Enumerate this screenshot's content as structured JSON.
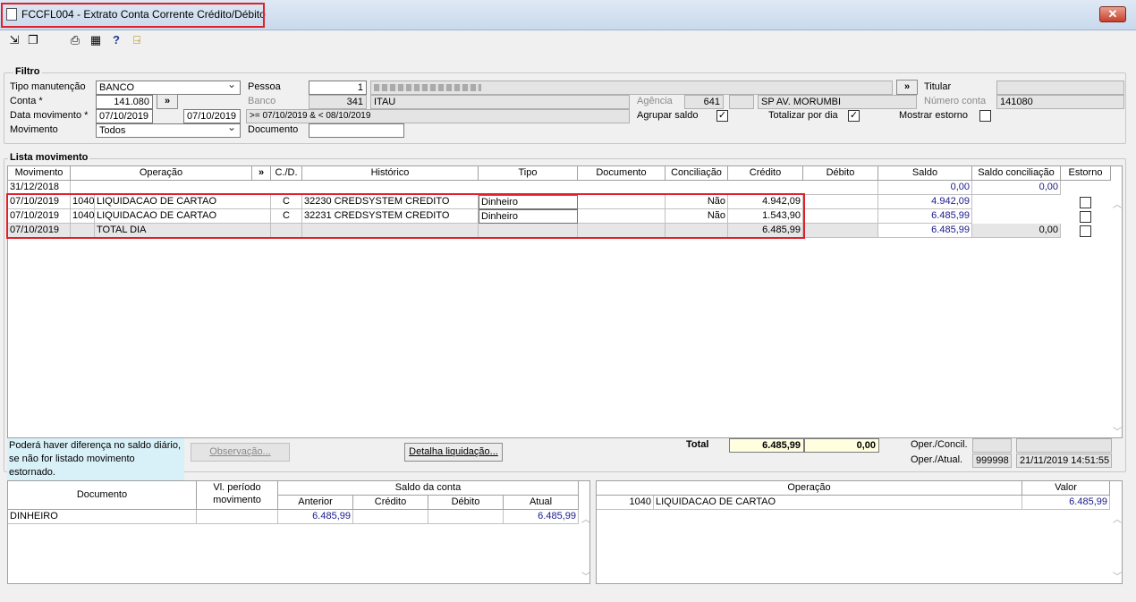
{
  "window": {
    "title": "FCCFL004 - Extrato Conta Corrente Crédito/Débito",
    "close": "✕"
  },
  "toolbar": {
    "icons": [
      "export-icon",
      "copy-icon",
      "print-icon",
      "calendar-icon",
      "help-icon",
      "exit-door-icon"
    ]
  },
  "filtro": {
    "title": "Filtro",
    "tipo_manutencao_label": "Tipo manutenção",
    "tipo_manutencao_value": "BANCO",
    "conta_label": "Conta *",
    "conta_value": "141.080",
    "conta_btn": "»",
    "data_movimento_label": "Data movimento *",
    "data_inicio": "07/10/2019",
    "data_fim": "07/10/2019",
    "data_expr": ">= 07/10/2019 & < 08/10/2019",
    "movimento_label": "Movimento",
    "movimento_value": "Todos",
    "pessoa_label": "Pessoa",
    "pessoa_value": "1",
    "pessoa_btn": "»",
    "banco_label": "Banco",
    "banco_value": "341",
    "banco_nome": "ITAU",
    "documento_label": "Documento",
    "documento_value": "",
    "agencia_label": "Agência",
    "agencia_value": "641",
    "agencia_nome": "SP AV. MORUMBI",
    "agrupar_saldo_label": "Agrupar saldo",
    "agrupar_saldo_checked": true,
    "totalizar_label": "Totalizar por dia",
    "totalizar_checked": true,
    "mostrar_estorno_label": "Mostrar estorno",
    "mostrar_estorno_checked": false,
    "titular_label": "Titular",
    "titular_value": "",
    "numero_conta_label": "Número conta",
    "numero_conta_value": "141080"
  },
  "lista": {
    "title": "Lista movimento",
    "headers": [
      "Movimento",
      "Operação",
      "»",
      "C./D.",
      "Histórico",
      "Tipo",
      "Documento",
      "Conciliação",
      "Crédito",
      "Débito",
      "Saldo",
      "Saldo conciliação",
      "Estorno"
    ],
    "opening_row": {
      "movimento": "31/12/2018",
      "saldo": "0,00",
      "saldo_conciliacao": "0,00"
    },
    "rows": [
      {
        "movimento": "07/10/2019",
        "op_code": "1040",
        "operacao": "LIQUIDACAO DE CARTAO",
        "cd": "C",
        "historico": "32230 CREDSYSTEM CREDITO",
        "tipo": "Dinheiro",
        "documento": "",
        "conciliacao": "Não",
        "credito": "4.942,09",
        "debito": "",
        "saldo": "4.942,09",
        "saldo_conciliacao": "",
        "estorno": false
      },
      {
        "movimento": "07/10/2019",
        "op_code": "1040",
        "operacao": "LIQUIDACAO DE CARTAO",
        "cd": "C",
        "historico": "32231 CREDSYSTEM CREDITO",
        "tipo": "Dinheiro",
        "documento": "",
        "conciliacao": "Não",
        "credito": "1.543,90",
        "debito": "",
        "saldo": "6.485,99",
        "saldo_conciliacao": "",
        "estorno": false
      }
    ],
    "total_row": {
      "movimento": "07/10/2019",
      "operacao": "TOTAL DIA",
      "credito": "6.485,99",
      "saldo": "6.485,99",
      "saldo_conciliacao": "0,00"
    }
  },
  "footer": {
    "notice_line1": "Poderá haver diferença no saldo diário,",
    "notice_line2": "se não for listado movimento estornado.",
    "observacao_btn": "Observação...",
    "detalha_btn": "Detalha liquidação...",
    "total_label": "Total",
    "total_credito": "6.485,99",
    "total_debito": "0,00",
    "oper_concil_label": "Oper./Concil.",
    "oper_atual_label": "Oper./Atual.",
    "oper_concil_value": "",
    "oper_concil_date": "",
    "oper_atual_value": "999998",
    "oper_atual_date": "21/11/2019 14:51:55"
  },
  "saldo_grid": {
    "h_documento": "Documento",
    "h_vl_periodo": "Vl. período movimento",
    "h_saldo_conta": "Saldo da conta",
    "h_anterior": "Anterior",
    "h_credito": "Crédito",
    "h_debito": "Débito",
    "h_atual": "Atual",
    "row": {
      "documento": "DINHEIRO",
      "vl_periodo": "",
      "anterior": "6.485,99",
      "credito": "",
      "debito": "",
      "atual": "6.485,99"
    }
  },
  "operacao_grid": {
    "h_operacao": "Operação",
    "h_valor": "Valor",
    "row": {
      "code": "1040",
      "operacao": "LIQUIDACAO DE CARTAO",
      "valor": "6.485,99"
    }
  }
}
